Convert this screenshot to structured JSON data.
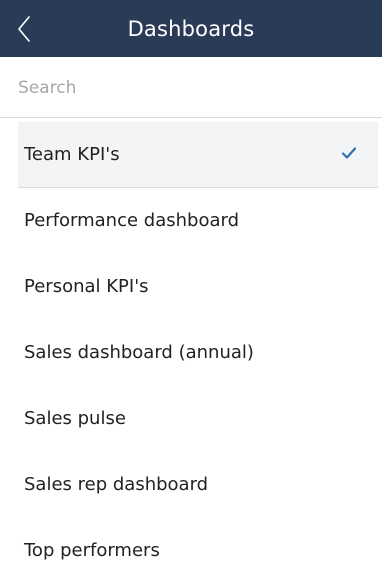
{
  "header": {
    "title": "Dashboards",
    "background": "#293b57"
  },
  "search": {
    "placeholder": "Search",
    "value": ""
  },
  "dashboards": {
    "items": [
      {
        "label": "Team KPI's",
        "selected": true
      },
      {
        "label": "Performance dashboard",
        "selected": false
      },
      {
        "label": "Personal KPI's",
        "selected": false
      },
      {
        "label": "Sales dashboard (annual)",
        "selected": false
      },
      {
        "label": "Sales pulse",
        "selected": false
      },
      {
        "label": "Sales rep dashboard",
        "selected": false
      },
      {
        "label": "Top performers",
        "selected": false
      }
    ],
    "check_color": "#2f6fb3",
    "check_icon": "checkmark-icon"
  }
}
